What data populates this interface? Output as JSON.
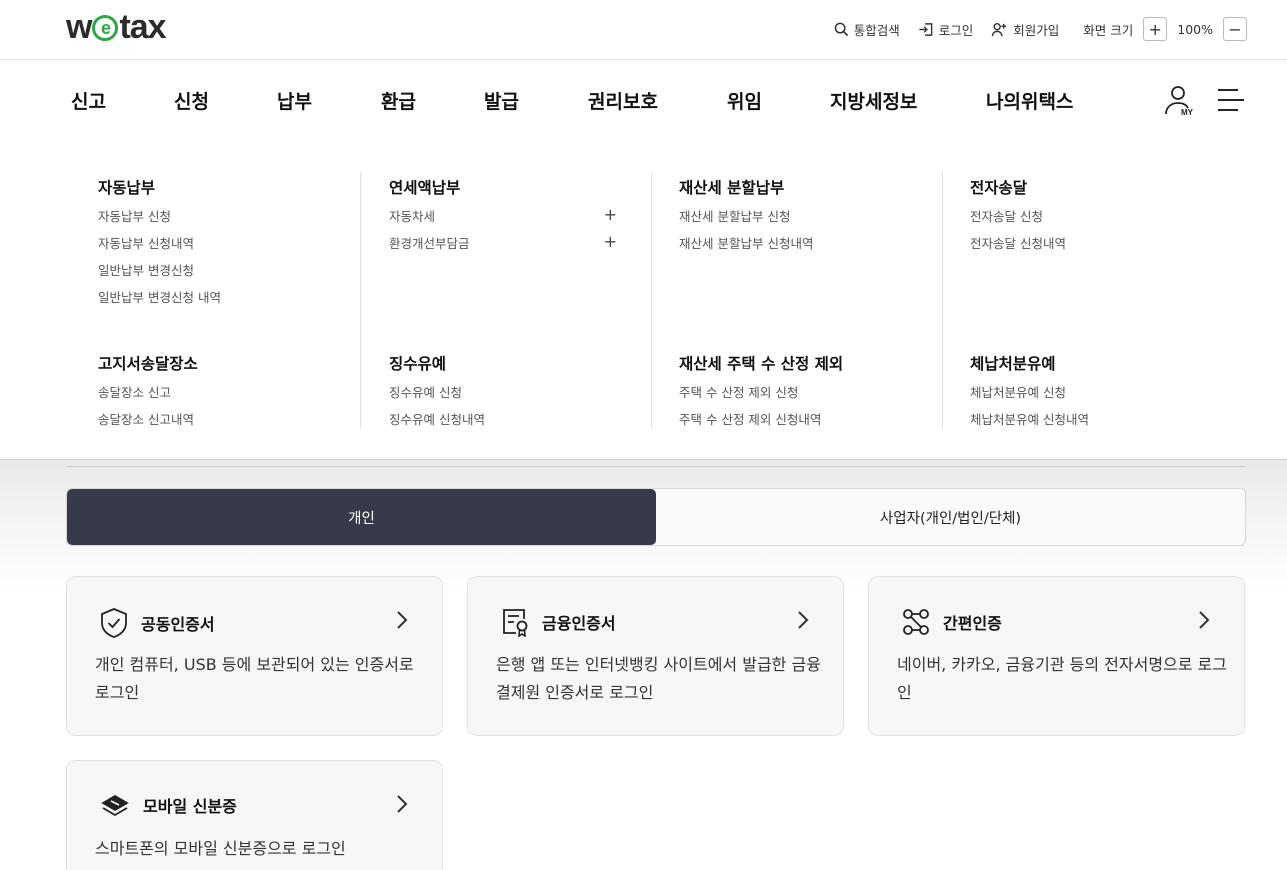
{
  "header": {
    "logo_left": "w",
    "logo_e": "e",
    "logo_right": "tax",
    "util": {
      "search": "통합검색",
      "login": "로그인",
      "signup": "회원가입",
      "zoom_label": "화면 크기",
      "zoom_in": "+",
      "zoom_value": "100%",
      "zoom_out": "−"
    }
  },
  "nav": {
    "items": [
      "신고",
      "신청",
      "납부",
      "환급",
      "발급",
      "권리보호",
      "위임",
      "지방세정보",
      "나의위택스"
    ]
  },
  "mega_menu": {
    "columns": [
      {
        "groups": [
          {
            "title": "자동납부",
            "items": [
              "자동납부 신청",
              "자동납부 신청내역",
              "일반납부 변경신청",
              "일반납부 변경신청 내역"
            ]
          },
          {
            "title": "고지서송달장소",
            "items": [
              "송달장소 신고",
              "송달장소 신고내역"
            ]
          }
        ]
      },
      {
        "groups": [
          {
            "title": "연세액납부",
            "items": [
              "자동차세",
              "환경개선부담금"
            ],
            "expand": "+"
          },
          {
            "title": "징수유예",
            "items": [
              "징수유예 신청",
              "징수유예 신청내역"
            ]
          }
        ]
      },
      {
        "groups": [
          {
            "title": "재산세 분할납부",
            "items": [
              "재산세 분할납부 신청",
              "재산세 분할납부 신청내역"
            ]
          },
          {
            "title": "재산세 주택 수 산정 제외",
            "items": [
              "주택 수 산정 제외 신청",
              "주택 수 산정 제외 신청내역"
            ]
          }
        ]
      },
      {
        "groups": [
          {
            "title": "전자송달",
            "items": [
              "전자송달 신청",
              "전자송달 신청내역"
            ]
          },
          {
            "title": "체납처분유예",
            "items": [
              "체납처분유예 신청",
              "체납처분유예 신청내역"
            ]
          }
        ]
      }
    ]
  },
  "login_tabs": {
    "personal": "개인",
    "business": "사업자(개인/법인/단체)"
  },
  "cards": [
    {
      "title": "공동인증서",
      "desc": "개인 컴퓨터, USB 등에 보관되어 있는 인증서로 로그인",
      "icon": "shield-check-icon"
    },
    {
      "title": "금융인증서",
      "desc": "은행 앱 또는 인터넷뱅킹 사이트에서 발급한 금융결제원 인증서로 로그인",
      "icon": "certificate-icon"
    },
    {
      "title": "간편인증",
      "desc": "네이버, 카카오, 금융기관 등의 전자서명으로 로그인",
      "icon": "network-icon"
    },
    {
      "title": "모바일 신분증",
      "desc": "스마트폰의 모바일 신분증으로 로그인",
      "icon": "mobile-id-icon"
    }
  ],
  "colors": {
    "accent_green": "#2aa846",
    "tab_active": "#373a4a"
  }
}
